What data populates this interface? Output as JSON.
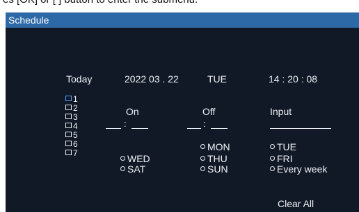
{
  "caption_text": "es [OK] or [ ] button to enter the submenu.",
  "window": {
    "title": "Schedule"
  },
  "today": {
    "label": "Today",
    "date": "2022 03 . 22",
    "weekday": "TUE",
    "time": "14 : 20 : 08"
  },
  "slots": [
    "1",
    "2",
    "3",
    "4",
    "5",
    "6",
    "7"
  ],
  "columns": {
    "on": "On",
    "off": "Off",
    "input": "Input"
  },
  "time_separator": ":",
  "days": {
    "mon": "MON",
    "tue": "TUE",
    "wed": "WED",
    "thu": "THU",
    "fri": "FRI",
    "sat": "SAT",
    "sun": "SUN",
    "every_week": "Every week"
  },
  "buttons": {
    "clear_all": "Clear All"
  },
  "colors": {
    "background": "#111926",
    "title_bar": "#2d69a6",
    "selected_slot_box": "#5aa0ff"
  }
}
